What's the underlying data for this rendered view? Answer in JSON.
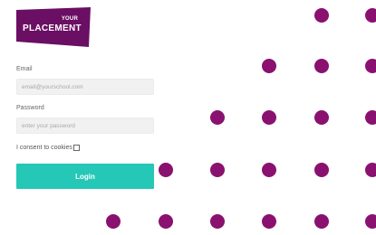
{
  "brand": {
    "logo_small": "YOUR",
    "logo_big": "PLACEMENT",
    "logo_color": "#6a0f63",
    "dot_color": "#8a1170"
  },
  "form": {
    "email_label": "Email",
    "email_placeholder": "email@yourschool.com",
    "password_label": "Password",
    "password_placeholder": "enter your password",
    "consent_label": "I consent to cookies",
    "login_label": "Login",
    "accent_color": "#25c7b6"
  }
}
